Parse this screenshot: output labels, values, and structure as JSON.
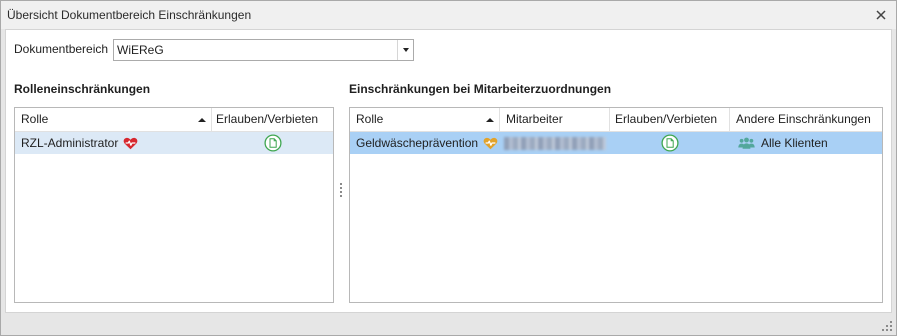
{
  "window": {
    "title": "Übersicht Dokumentbereich Einschränkungen",
    "close_icon": "close-icon"
  },
  "filter": {
    "label": "Dokumentbereich",
    "selected": "WiEReG",
    "dropdown_icon": "chevron-down-icon"
  },
  "role_restrictions": {
    "heading": "Rolleneinschränkungen",
    "columns": [
      "Rolle",
      "Erlauben/Verbieten"
    ],
    "sort_icon": "sort-ascending-icon",
    "rows": [
      {
        "role": "RZL-Administrator",
        "role_icon": "heart-icon",
        "permission_icon": "document-circle-icon"
      }
    ]
  },
  "employee_restrictions": {
    "heading": "Einschränkungen bei Mitarbeiterzuordnungen",
    "columns": [
      "Rolle",
      "Mitarbeiter",
      "Erlauben/Verbieten",
      "Andere Einschränkungen"
    ],
    "sort_icon": "sort-ascending-icon",
    "rows": [
      {
        "role": "Geldwäscheprävention",
        "role_icon": "heart-icon",
        "permission_icon": "document-circle-icon",
        "other": "Alle Klienten",
        "other_icon": "people-icon"
      }
    ]
  },
  "colors": {
    "role_icon_admin": "#d7282f",
    "role_icon_aml": "#e2a32c",
    "permission_icon": "#3fa650",
    "people_icon": "#52a79c",
    "row_selected_inactive": "#dce9f6",
    "row_selected_active": "#a9d0f5"
  }
}
